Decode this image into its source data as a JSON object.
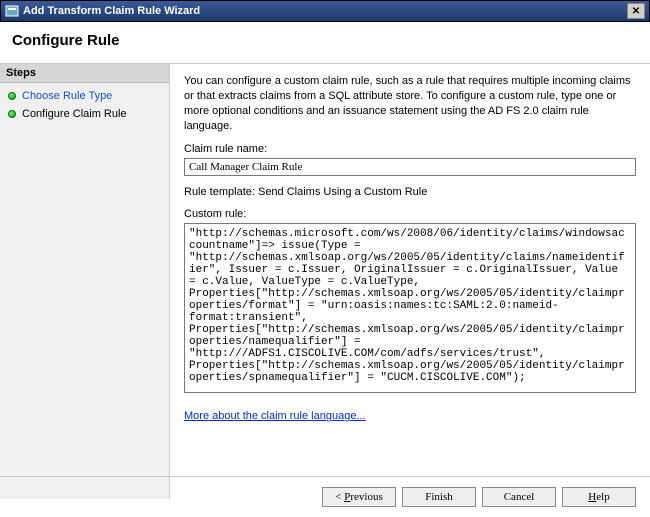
{
  "window": {
    "title": "Add Transform Claim Rule Wizard"
  },
  "header": {
    "title": "Configure Rule"
  },
  "sidebar": {
    "heading": "Steps",
    "items": [
      {
        "label": "Choose Rule Type"
      },
      {
        "label": "Configure Claim Rule"
      }
    ]
  },
  "main": {
    "description": "You can configure a custom claim rule, such as a rule that requires multiple incoming claims or that extracts claims from a SQL attribute store. To configure a custom rule, type one or more optional conditions and an issuance statement using the AD FS 2.0 claim rule language.",
    "rule_name_label": "Claim rule name:",
    "rule_name_value": "Call Manager Claim Rule",
    "template_label": "Rule template: Send Claims Using a Custom Rule",
    "custom_rule_label": "Custom rule:",
    "custom_rule_value": "\"http://schemas.microsoft.com/ws/2008/06/identity/claims/windowsaccountname\"]=> issue(Type = \"http://schemas.xmlsoap.org/ws/2005/05/identity/claims/nameidentifier\", Issuer = c.Issuer, OriginalIssuer = c.OriginalIssuer, Value = c.Value, ValueType = c.ValueType, Properties[\"http://schemas.xmlsoap.org/ws/2005/05/identity/claimproperties/format\"] = \"urn:oasis:names:tc:SAML:2.0:nameid-format:transient\", Properties[\"http://schemas.xmlsoap.org/ws/2005/05/identity/claimproperties/namequalifier\"] = \"http:///ADFS1.CISCOLIVE.COM/com/adfs/services/trust\", Properties[\"http://schemas.xmlsoap.org/ws/2005/05/identity/claimproperties/spnamequalifier\"] = \"CUCM.CISCOLIVE.COM\");",
    "link_label": "More about the claim rule language..."
  },
  "buttons": {
    "previous_pre": "< ",
    "previous_u": "P",
    "previous_post": "revious",
    "finish": "Finish",
    "cancel": "Cancel",
    "help_u": "H",
    "help_post": "elp"
  }
}
